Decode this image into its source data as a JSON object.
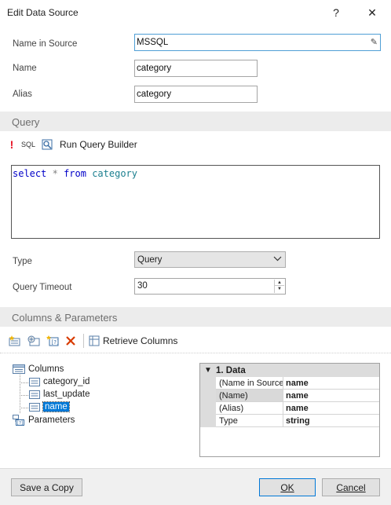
{
  "window": {
    "title": "Edit Data Source",
    "help": "?",
    "close": "✕"
  },
  "source": {
    "name_in_source_label": "Name in Source",
    "name_in_source_value": "MSSQL",
    "name_label": "Name",
    "name_value": "category",
    "alias_label": "Alias",
    "alias_value": "category"
  },
  "query": {
    "section_title": "Query",
    "sql_label": "SQL",
    "builder_label": "Run Query Builder",
    "code": {
      "kw1": "select",
      "star": "*",
      "kw2": "from",
      "table": "category"
    },
    "type_label": "Type",
    "type_value": "Query",
    "timeout_label": "Query Timeout",
    "timeout_value": "30"
  },
  "columns": {
    "section_title": "Columns & Parameters",
    "retrieve_label": "Retrieve Columns",
    "tree": {
      "root": "Columns",
      "items": [
        "category_id",
        "last_update",
        "name"
      ],
      "parameters": "Parameters"
    },
    "properties": {
      "group": "1. Data",
      "rows": [
        {
          "name": "(Name in Source",
          "value": "name"
        },
        {
          "name": "(Name)",
          "value": "name"
        },
        {
          "name": "(Alias)",
          "value": "name"
        },
        {
          "name": "Type",
          "value": "string"
        }
      ]
    }
  },
  "footer": {
    "save_copy": "Save a Copy",
    "ok": "OK",
    "cancel": "Cancel"
  },
  "icons": [
    "warning-icon",
    "sql-icon",
    "query-builder-icon",
    "new-column-icon",
    "calc-column-icon",
    "new-parameter-icon",
    "delete-icon",
    "retrieve-columns-icon",
    "table-icon",
    "column-icon",
    "parameter-icon"
  ],
  "colors": {
    "accent": "#0078d7",
    "section_bg": "#ececec",
    "keyword": "#0000c8",
    "identifier": "#1b7f8f",
    "warning": "#e81123"
  }
}
